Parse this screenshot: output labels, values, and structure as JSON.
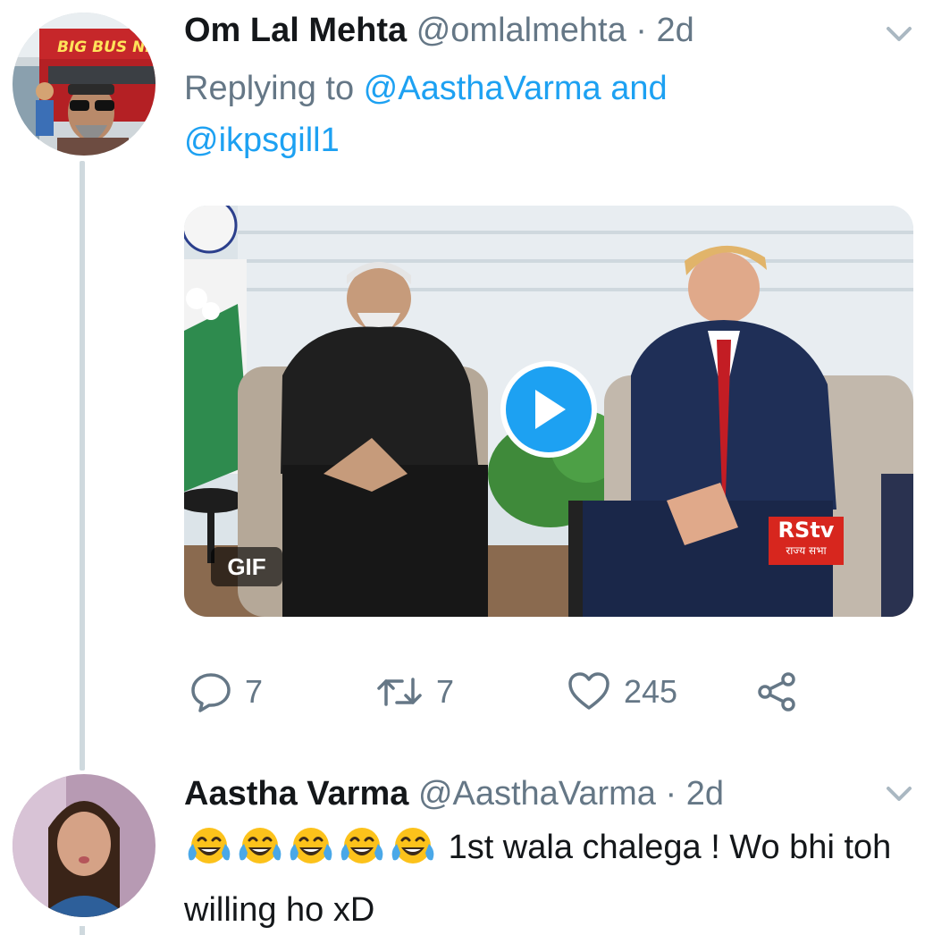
{
  "reply_tweet": {
    "display_name": "Om Lal Mehta",
    "handle": "@omlalmehta",
    "separator": " · ",
    "time": "2d",
    "replying_prefix": "Replying to ",
    "mention_1": "@AasthaVarma",
    "mention_joiner": " and",
    "mention_2": "@ikpsgill1",
    "media": {
      "type_badge": "GIF",
      "watermark_big": "RStv",
      "watermark_small": "राज्य सभा"
    },
    "actions": {
      "reply_count": "7",
      "retweet_count": "7",
      "like_count": "245"
    },
    "avatar_sign_text": "BIG BUS NEW YORK"
  },
  "original_tweet": {
    "display_name": "Aastha Varma",
    "handle": "@AasthaVarma",
    "separator": " · ",
    "time": "2d",
    "emoji_count": 5,
    "body": "1st wala chalega ! Wo bhi toh willing ho xD"
  },
  "icons": {
    "reply": "speech-bubble-icon",
    "retweet": "retweet-icon",
    "like": "heart-icon",
    "share": "share-icon",
    "menu": "chevron-down-icon",
    "play": "play-icon",
    "emoji": "face-with-tears-of-joy-icon"
  },
  "colors": {
    "link_blue": "#1da1f2",
    "secondary_text": "#657786",
    "primary_text": "#14171a",
    "thread_line": "#cfd9de"
  }
}
